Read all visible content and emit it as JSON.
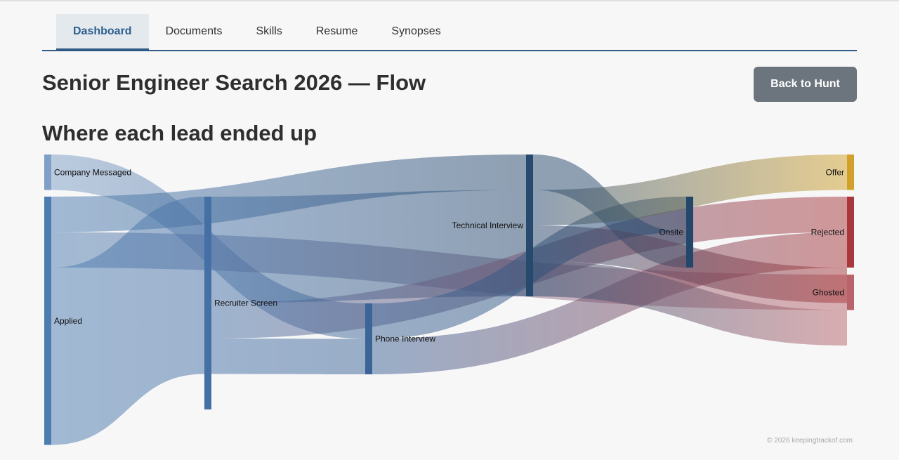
{
  "nav": {
    "tabs": [
      {
        "label": "Dashboard",
        "active": true
      },
      {
        "label": "Documents",
        "active": false
      },
      {
        "label": "Skills",
        "active": false
      },
      {
        "label": "Resume",
        "active": false
      },
      {
        "label": "Synopses",
        "active": false
      }
    ]
  },
  "page": {
    "title": "Senior Engineer Search 2026 — Flow",
    "back_label": "Back to Hunt",
    "subtitle": "Where each lead ended up",
    "footer": "© 2026 keepingtrackof.com"
  },
  "chart_data": {
    "type": "sankey",
    "nodes": [
      {
        "id": "company",
        "label": "Company Messaged",
        "column": 0,
        "value": 1,
        "color": "#7f9fc6"
      },
      {
        "id": "applied",
        "label": "Applied",
        "column": 0,
        "value": 7,
        "color": "#4d7cb0"
      },
      {
        "id": "recruiter",
        "label": "Recruiter Screen",
        "column": 1,
        "value": 6,
        "color": "#4570a5"
      },
      {
        "id": "phone",
        "label": "Phone Interview",
        "column": 2,
        "value": 2,
        "color": "#3c6496"
      },
      {
        "id": "technical",
        "label": "Technical Interview",
        "column": 3,
        "value": 4,
        "color": "#28496e"
      },
      {
        "id": "onsite",
        "label": "Onsite",
        "column": 4,
        "value": 2,
        "color": "#22476b"
      },
      {
        "id": "offer",
        "label": "Offer",
        "column": 5,
        "value": 1,
        "color": "#d1a12a"
      },
      {
        "id": "rejected",
        "label": "Rejected",
        "column": 5,
        "value": 2,
        "color": "#a8383b"
      },
      {
        "id": "ghosted",
        "label": "Ghosted",
        "column": 5,
        "value": 1,
        "color": "#b8646a"
      }
    ],
    "links": [
      {
        "source": "company",
        "target": "phone",
        "value": 1
      },
      {
        "source": "applied",
        "target": "technical",
        "value": 1
      },
      {
        "source": "applied",
        "target": "ghosted",
        "value": 1
      },
      {
        "source": "applied",
        "target": "recruiter",
        "value": 5
      },
      {
        "source": "recruiter",
        "target": "technical",
        "value": 3
      },
      {
        "source": "recruiter",
        "target": "rejected",
        "value": 1
      },
      {
        "source": "recruiter",
        "target": "phone",
        "value": 1
      },
      {
        "source": "phone",
        "target": "onsite",
        "value": 1
      },
      {
        "source": "phone",
        "target": "rejected",
        "value": 1
      },
      {
        "source": "technical",
        "target": "onsite",
        "value": 1
      },
      {
        "source": "technical",
        "target": "offer",
        "value": 1
      },
      {
        "source": "technical",
        "target": "rejected",
        "value": 1
      },
      {
        "source": "technical",
        "target": "ghosted",
        "value": 1
      }
    ]
  }
}
